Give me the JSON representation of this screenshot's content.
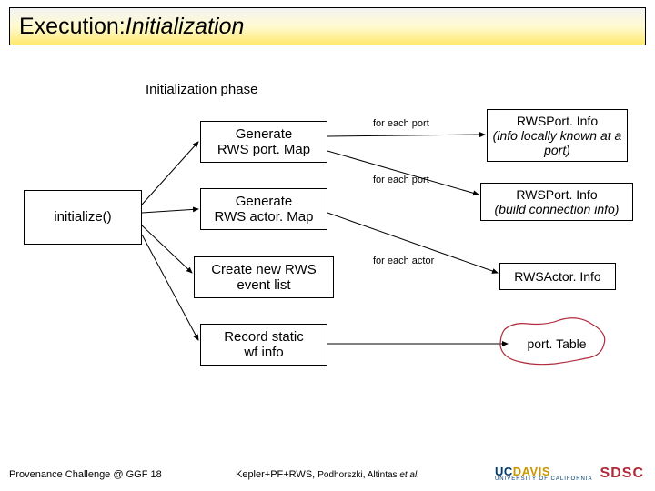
{
  "title": {
    "prefix": "Execution: ",
    "emphasis": "Initialization"
  },
  "phase_label": "Initialization phase",
  "boxes": {
    "initialize": "initialize()",
    "gen_portmap": "Generate\nRWS port. Map",
    "gen_actormap": "Generate\nRWS actor. Map",
    "create_eventlist": "Create new RWS\nevent list",
    "record_static": "Record static\nwf info"
  },
  "info": {
    "portinfo1": {
      "title": "RWSPort. Info",
      "sub": "(info locally known at a port)"
    },
    "portinfo2": {
      "title": "RWSPort. Info",
      "sub": "(build connection info)"
    },
    "actorinfo": "RWSActor. Info",
    "porttable": "port. Table"
  },
  "edge_labels": {
    "each_port_1": "for each port",
    "each_port_2": "for each port",
    "each_actor": "for each actor"
  },
  "footer": {
    "left": "Provenance Challenge @ GGF 18",
    "center_prefix": "Kepler+PF+RWS, ",
    "center_authors": "Podhorszki, Altintas ",
    "center_etal": "et al."
  },
  "logos": {
    "ucd_uc": "UC",
    "ucd_davis": "DAVIS",
    "ucd_sub": "UNIVERSITY OF CALIFORNIA",
    "sdsc": "SDSC"
  }
}
